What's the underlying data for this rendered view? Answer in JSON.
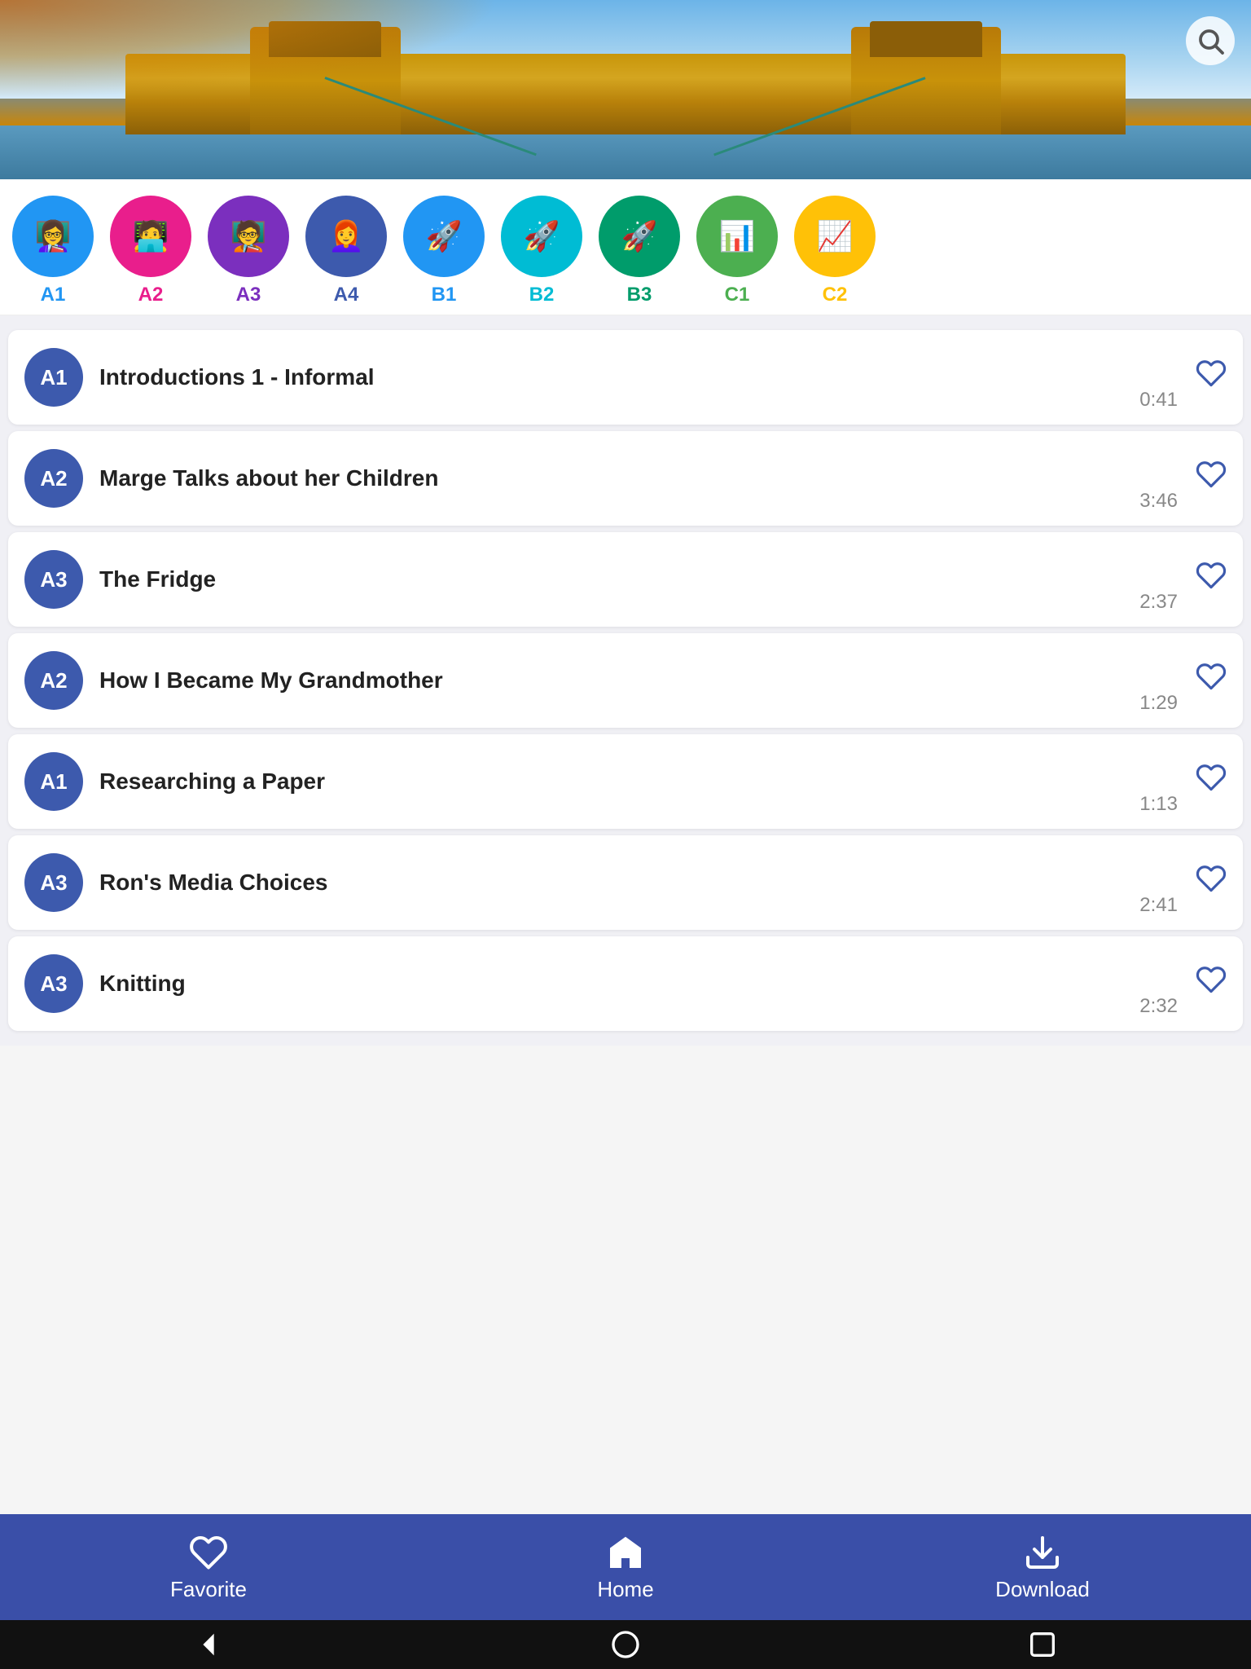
{
  "hero": {
    "search_title": "Search"
  },
  "levels": [
    {
      "id": "A1",
      "label": "A1",
      "color": "#2196F3",
      "emoji": "👩‍🏫"
    },
    {
      "id": "A2",
      "label": "A2",
      "color": "#E91E8C",
      "emoji": "🧑‍💻"
    },
    {
      "id": "A3",
      "label": "A3",
      "color": "#7B2FBE",
      "emoji": "🧑‍🏫"
    },
    {
      "id": "A4",
      "label": "A4",
      "color": "#3d5aad",
      "emoji": "👩‍🦰"
    },
    {
      "id": "B1",
      "label": "B1",
      "color": "#2196F3",
      "emoji": "🚀"
    },
    {
      "id": "B2",
      "label": "B2",
      "color": "#00BCD4",
      "emoji": "🚀"
    },
    {
      "id": "B3",
      "label": "B3",
      "color": "#009688",
      "emoji": "🚀"
    },
    {
      "id": "C1",
      "label": "C1",
      "color": "#4CAF50",
      "emoji": "📊"
    },
    {
      "id": "C2",
      "label": "C2",
      "color": "#FFC107",
      "emoji": "📈"
    }
  ],
  "tracks": [
    {
      "level": "A1",
      "title": "Introductions 1 - Informal",
      "duration": "0:41"
    },
    {
      "level": "A2",
      "title": "Marge Talks about her Children",
      "duration": "3:46"
    },
    {
      "level": "A3",
      "title": "The Fridge",
      "duration": "2:37"
    },
    {
      "level": "A2",
      "title": "How I Became My Grandmother",
      "duration": "1:29"
    },
    {
      "level": "A1",
      "title": "Researching a Paper",
      "duration": "1:13"
    },
    {
      "level": "A3",
      "title": "Ron's Media Choices",
      "duration": "2:41"
    },
    {
      "level": "A3",
      "title": "Knitting",
      "duration": "2:32"
    }
  ],
  "bottomNav": {
    "favorite": "Favorite",
    "home": "Home",
    "download": "Download"
  },
  "systemNav": {
    "back": "◀",
    "home_circle": "●",
    "square": "■"
  }
}
